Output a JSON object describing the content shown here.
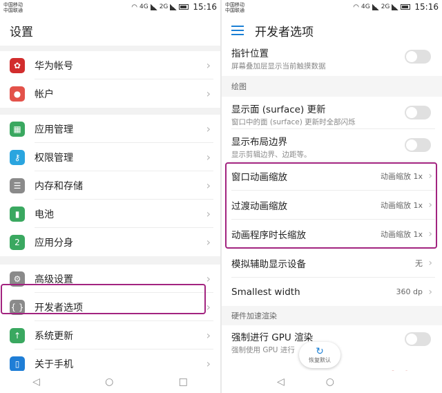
{
  "left": {
    "status": {
      "carrier1": "中国移动",
      "carrier2": "中国联通",
      "time": "15:16",
      "net1": "4G",
      "net2": "2G"
    },
    "title": "设置",
    "groups": [
      [
        {
          "label": "华为帐号",
          "icon": "huawei-icon",
          "color": "#d22d2d"
        },
        {
          "label": "帐户",
          "icon": "user-icon",
          "color": "#e3524a"
        }
      ],
      [
        {
          "label": "应用管理",
          "icon": "apps-icon",
          "color": "#3aa860"
        },
        {
          "label": "权限管理",
          "icon": "key-icon",
          "color": "#2aa5df"
        },
        {
          "label": "内存和存储",
          "icon": "storage-icon",
          "color": "#8a8a8a"
        },
        {
          "label": "电池",
          "icon": "battery-icon",
          "color": "#3aa860"
        },
        {
          "label": "应用分身",
          "icon": "app-twin-icon",
          "color": "#3aa860"
        }
      ],
      [
        {
          "label": "高级设置",
          "icon": "gear-icon",
          "color": "#8a8a8a"
        },
        {
          "label": "开发者选项",
          "icon": "braces-icon",
          "color": "#8a8a8a"
        },
        {
          "label": "系统更新",
          "icon": "update-icon",
          "color": "#3aa860"
        },
        {
          "label": "关于手机",
          "icon": "phone-icon",
          "color": "#1f7ed6"
        }
      ]
    ]
  },
  "right": {
    "status": {
      "carrier1": "中国移动",
      "carrier2": "中国联通",
      "time": "15:16",
      "net1": "4G",
      "net2": "2G"
    },
    "title": "开发者选项",
    "pointer": {
      "title": "指针位置",
      "sub": "屏幕叠加层显示当前触摸数据"
    },
    "section_draw": "绘图",
    "surface": {
      "title": "显示面 (surface) 更新",
      "sub": "窗口中的面 (surface) 更新时全部闪烁"
    },
    "layout": {
      "title": "显示布局边界",
      "sub": "显示剪辑边界、边距等。"
    },
    "window_anim": {
      "title": "窗口动画缩放",
      "value": "动画缩放 1x"
    },
    "transition_anim": {
      "title": "过渡动画缩放",
      "value": "动画缩放 1x"
    },
    "duration_anim": {
      "title": "动画程序时长缩放",
      "value": "动画缩放 1x"
    },
    "secondary_display": {
      "title": "模拟辅助显示设备",
      "value": "无"
    },
    "smallest_width": {
      "title": "Smallest width",
      "value": "360 dp"
    },
    "section_hw": "硬件加速渲染",
    "force_gpu": {
      "title": "强制进行 GPU 渲染",
      "sub": "强制使用 GPU 进行"
    },
    "restore": "恢复默认",
    "watermark": "云南龙网"
  }
}
